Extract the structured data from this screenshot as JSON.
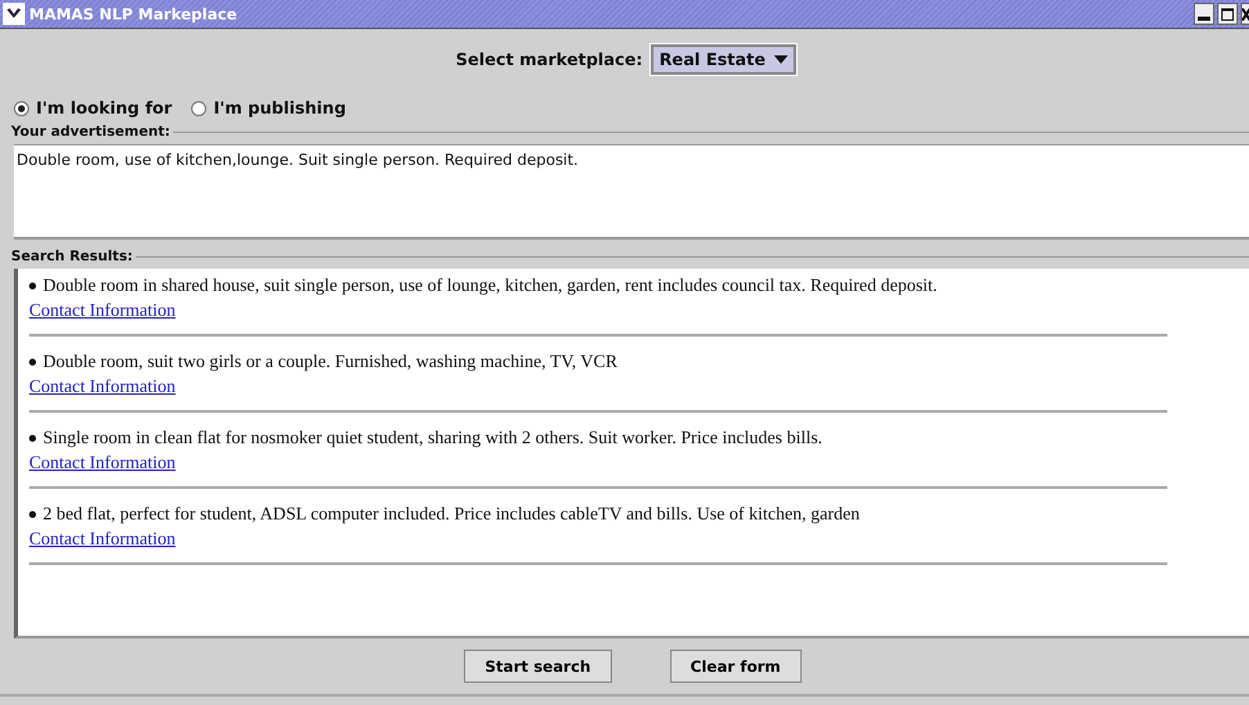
{
  "window": {
    "title": "MAMAS NLP Markeplace"
  },
  "marketplace": {
    "label": "Select marketplace:",
    "value": "Real Estate"
  },
  "modes": [
    {
      "label": "I'm looking for",
      "selected": true
    },
    {
      "label": "I'm publishing",
      "selected": false
    }
  ],
  "advertisement": {
    "label": "Your advertisement:",
    "value": "Double room, use of kitchen,lounge. Suit single person. Required deposit."
  },
  "results": {
    "label": "Search Results:",
    "items": [
      {
        "text": "Double room in shared house, suit single person, use of lounge, kitchen, garden, rent includes council tax. Required deposit.",
        "link": "Contact Information"
      },
      {
        "text": "Double room, suit two girls or a couple. Furnished, washing machine, TV, VCR",
        "link": "Contact Information"
      },
      {
        "text": "Single room in clean flat for nosmoker quiet student, sharing with 2 others. Suit worker. Price includes bills.",
        "link": "Contact Information"
      },
      {
        "text": "2 bed flat, perfect for student, ADSL computer included. Price includes cableTV and bills. Use of kitchen, garden",
        "link": "Contact Information"
      }
    ]
  },
  "buttons": [
    {
      "label": "Start search"
    },
    {
      "label": "Clear form"
    }
  ]
}
